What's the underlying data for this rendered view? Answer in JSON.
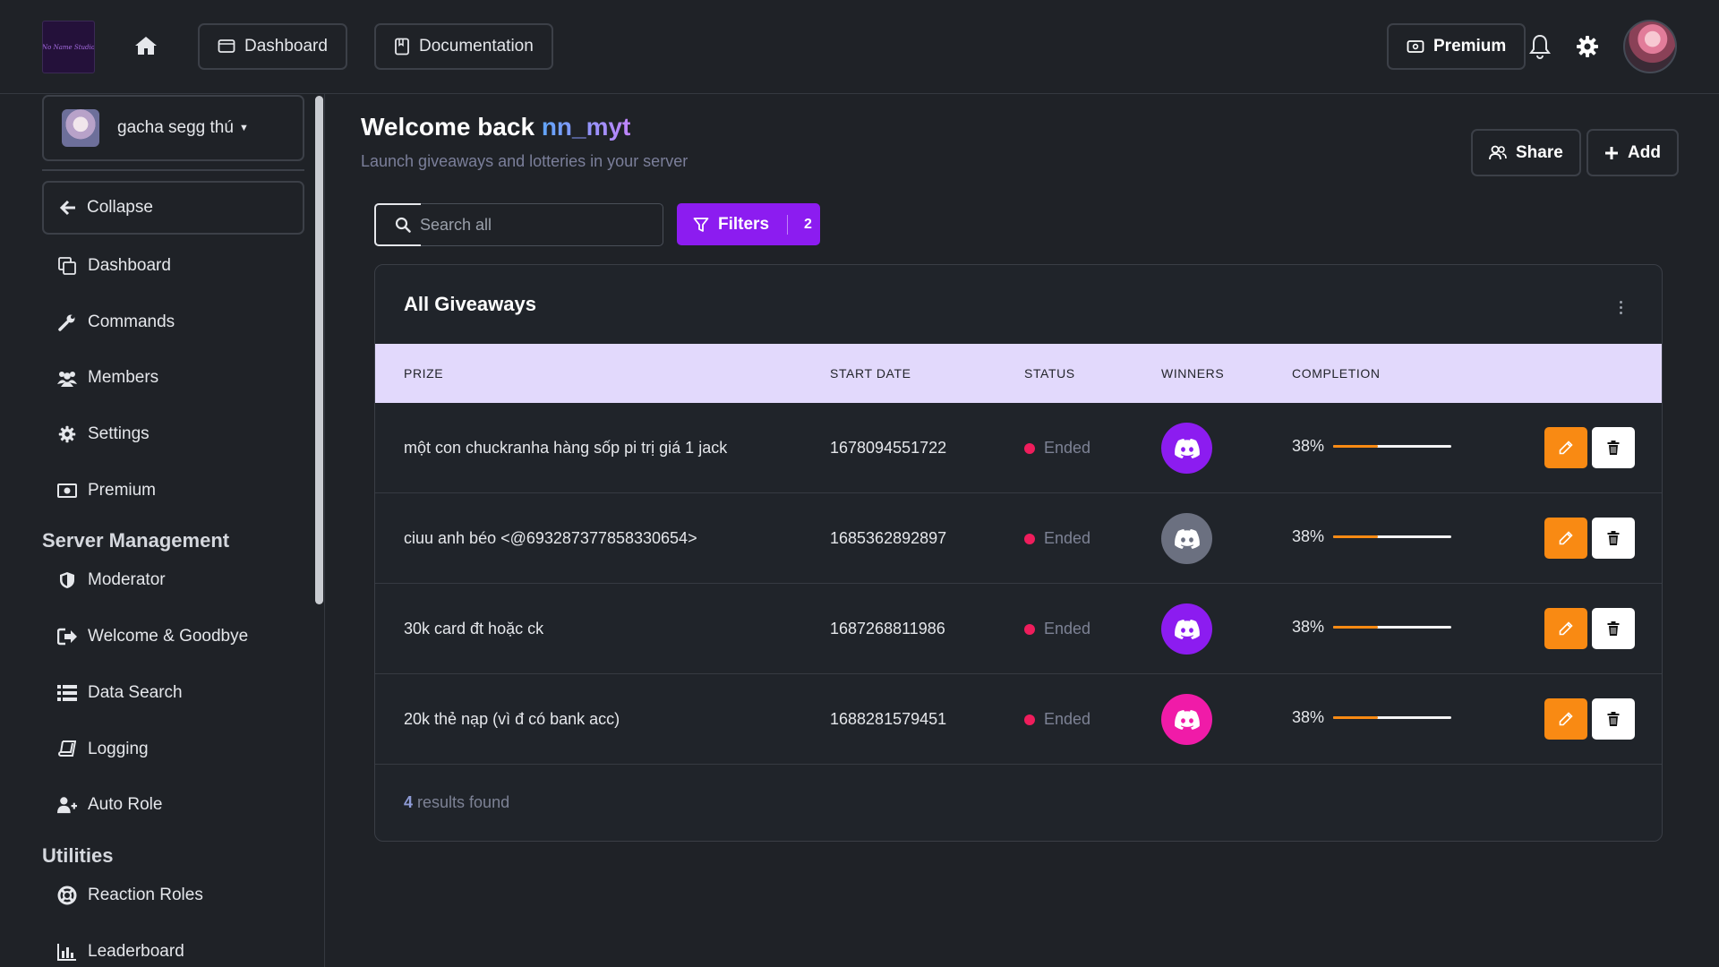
{
  "topbar": {
    "logo_text": "No Name Studio",
    "dashboard_label": "Dashboard",
    "documentation_label": "Documentation",
    "premium_label": "Premium"
  },
  "sidebar": {
    "server_name": "gacha segg thú",
    "collapse_label": "Collapse",
    "main_items": [
      {
        "label": "Dashboard",
        "icon": "copy-icon"
      },
      {
        "label": "Commands",
        "icon": "wrench-icon"
      },
      {
        "label": "Members",
        "icon": "users-icon"
      },
      {
        "label": "Settings",
        "icon": "gear-icon"
      },
      {
        "label": "Premium",
        "icon": "money-icon"
      }
    ],
    "server_management_title": "Server Management",
    "server_management_items": [
      {
        "label": "Moderator",
        "icon": "shield-icon"
      },
      {
        "label": "Welcome & Goodbye",
        "icon": "sign-out-icon"
      },
      {
        "label": "Data Search",
        "icon": "list-icon"
      },
      {
        "label": "Logging",
        "icon": "book-icon"
      },
      {
        "label": "Auto Role",
        "icon": "user-plus-icon"
      }
    ],
    "utilities_title": "Utilities",
    "utilities_items": [
      {
        "label": "Reaction Roles",
        "icon": "lifebuoy-icon"
      },
      {
        "label": "Leaderboard",
        "icon": "bar-chart-icon"
      }
    ]
  },
  "main": {
    "welcome_prefix": "Welcome back",
    "username": "nn_myt",
    "subtitle": "Launch giveaways and lotteries in your server",
    "share_label": "Share",
    "add_label": "Add",
    "search_placeholder": "Search all",
    "filters_label": "Filters",
    "filters_count": "2"
  },
  "giveaways": {
    "title": "All Giveaways",
    "columns": {
      "prize": "PRIZE",
      "start_date": "START DATE",
      "status": "STATUS",
      "winners": "WINNERS",
      "completion": "COMPLETION"
    },
    "rows": [
      {
        "prize": "một con chuckranha hàng sốp pi trị giá 1 jack",
        "start_date": "1678094551722",
        "status": "Ended",
        "winner_color": "#8c1cf0",
        "completion": "38%",
        "completion_value": 0.38
      },
      {
        "prize": "ciuu anh béo <@693287377858330654>",
        "start_date": "1685362892897",
        "status": "Ended",
        "winner_color": "#6b7080",
        "completion": "38%",
        "completion_value": 0.38
      },
      {
        "prize": "30k card đt hoặc ck",
        "start_date": "1687268811986",
        "status": "Ended",
        "winner_color": "#8c1cf0",
        "completion": "38%",
        "completion_value": 0.38
      },
      {
        "prize": "20k thẻ nạp (vì đ có bank acc)",
        "start_date": "1688281579451",
        "status": "Ended",
        "winner_color": "#f01ba8",
        "completion": "38%",
        "completion_value": 0.38
      }
    ],
    "results_count": "4",
    "results_suffix": "results found"
  },
  "colors": {
    "accent": "#8c1cf0",
    "orange": "#f98a13",
    "ended_dot": "#ef1d5c",
    "table_header": "#e2d9fc"
  }
}
